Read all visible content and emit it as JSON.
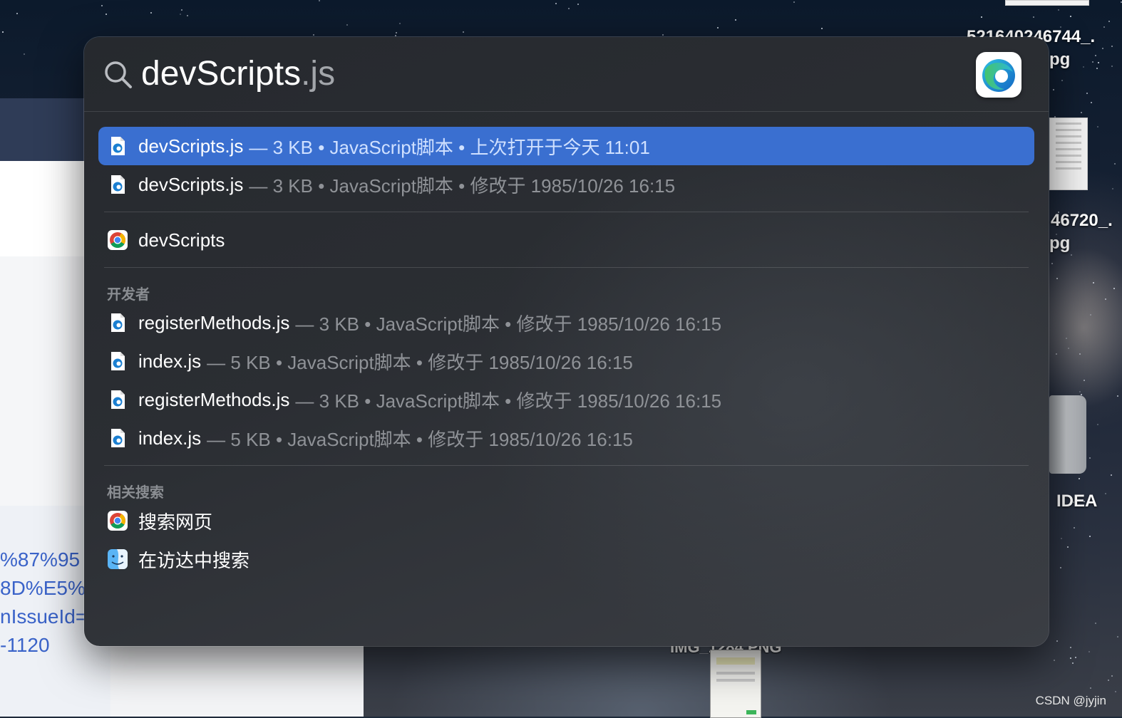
{
  "desktop": {
    "labels": {
      "file1_line1": "521640246744_.",
      "file1_line2": "pg",
      "file2_line1": "46720_.",
      "file2_line2": "pg",
      "drive": "IDEA",
      "bottom_file": "IMG_1284.PNG"
    },
    "background_window": {
      "link_lines": [
        "%87%95",
        "8D%E5%",
        "nIssueId=",
        "-1120"
      ]
    },
    "watermark": "CSDN @jyjin"
  },
  "spotlight": {
    "query": "devScripts",
    "query_ext": ".js",
    "preview_app_icon": "edge-app-icon",
    "results": [
      {
        "name": "devScripts.js",
        "meta": "— 3 KB • JavaScript脚本 • 上次打开于今天 11:01",
        "icon": "js-file-icon",
        "selected": true
      },
      {
        "name": "devScripts.js",
        "meta": "— 3 KB • JavaScript脚本 • 修改于 1985/10/26 16:15",
        "icon": "js-file-icon",
        "selected": false
      }
    ],
    "web_result": {
      "name": "devScripts",
      "icon": "chrome-icon"
    },
    "developer_section": {
      "title": "开发者",
      "items": [
        {
          "name": "registerMethods.js",
          "meta": "— 3 KB • JavaScript脚本 • 修改于 1985/10/26 16:15"
        },
        {
          "name": "index.js",
          "meta": "— 5 KB • JavaScript脚本 • 修改于 1985/10/26 16:15"
        },
        {
          "name": "registerMethods.js",
          "meta": "— 3 KB • JavaScript脚本 • 修改于 1985/10/26 16:15"
        },
        {
          "name": "index.js",
          "meta": "— 5 KB • JavaScript脚本 • 修改于 1985/10/26 16:15"
        }
      ]
    },
    "related_section": {
      "title": "相关搜索",
      "search_web": "搜索网页",
      "search_finder": "在访达中搜索"
    },
    "colors": {
      "selection": "#3a6fd0",
      "panel": "#2b2e33",
      "meta_text": "#8f9297"
    }
  }
}
